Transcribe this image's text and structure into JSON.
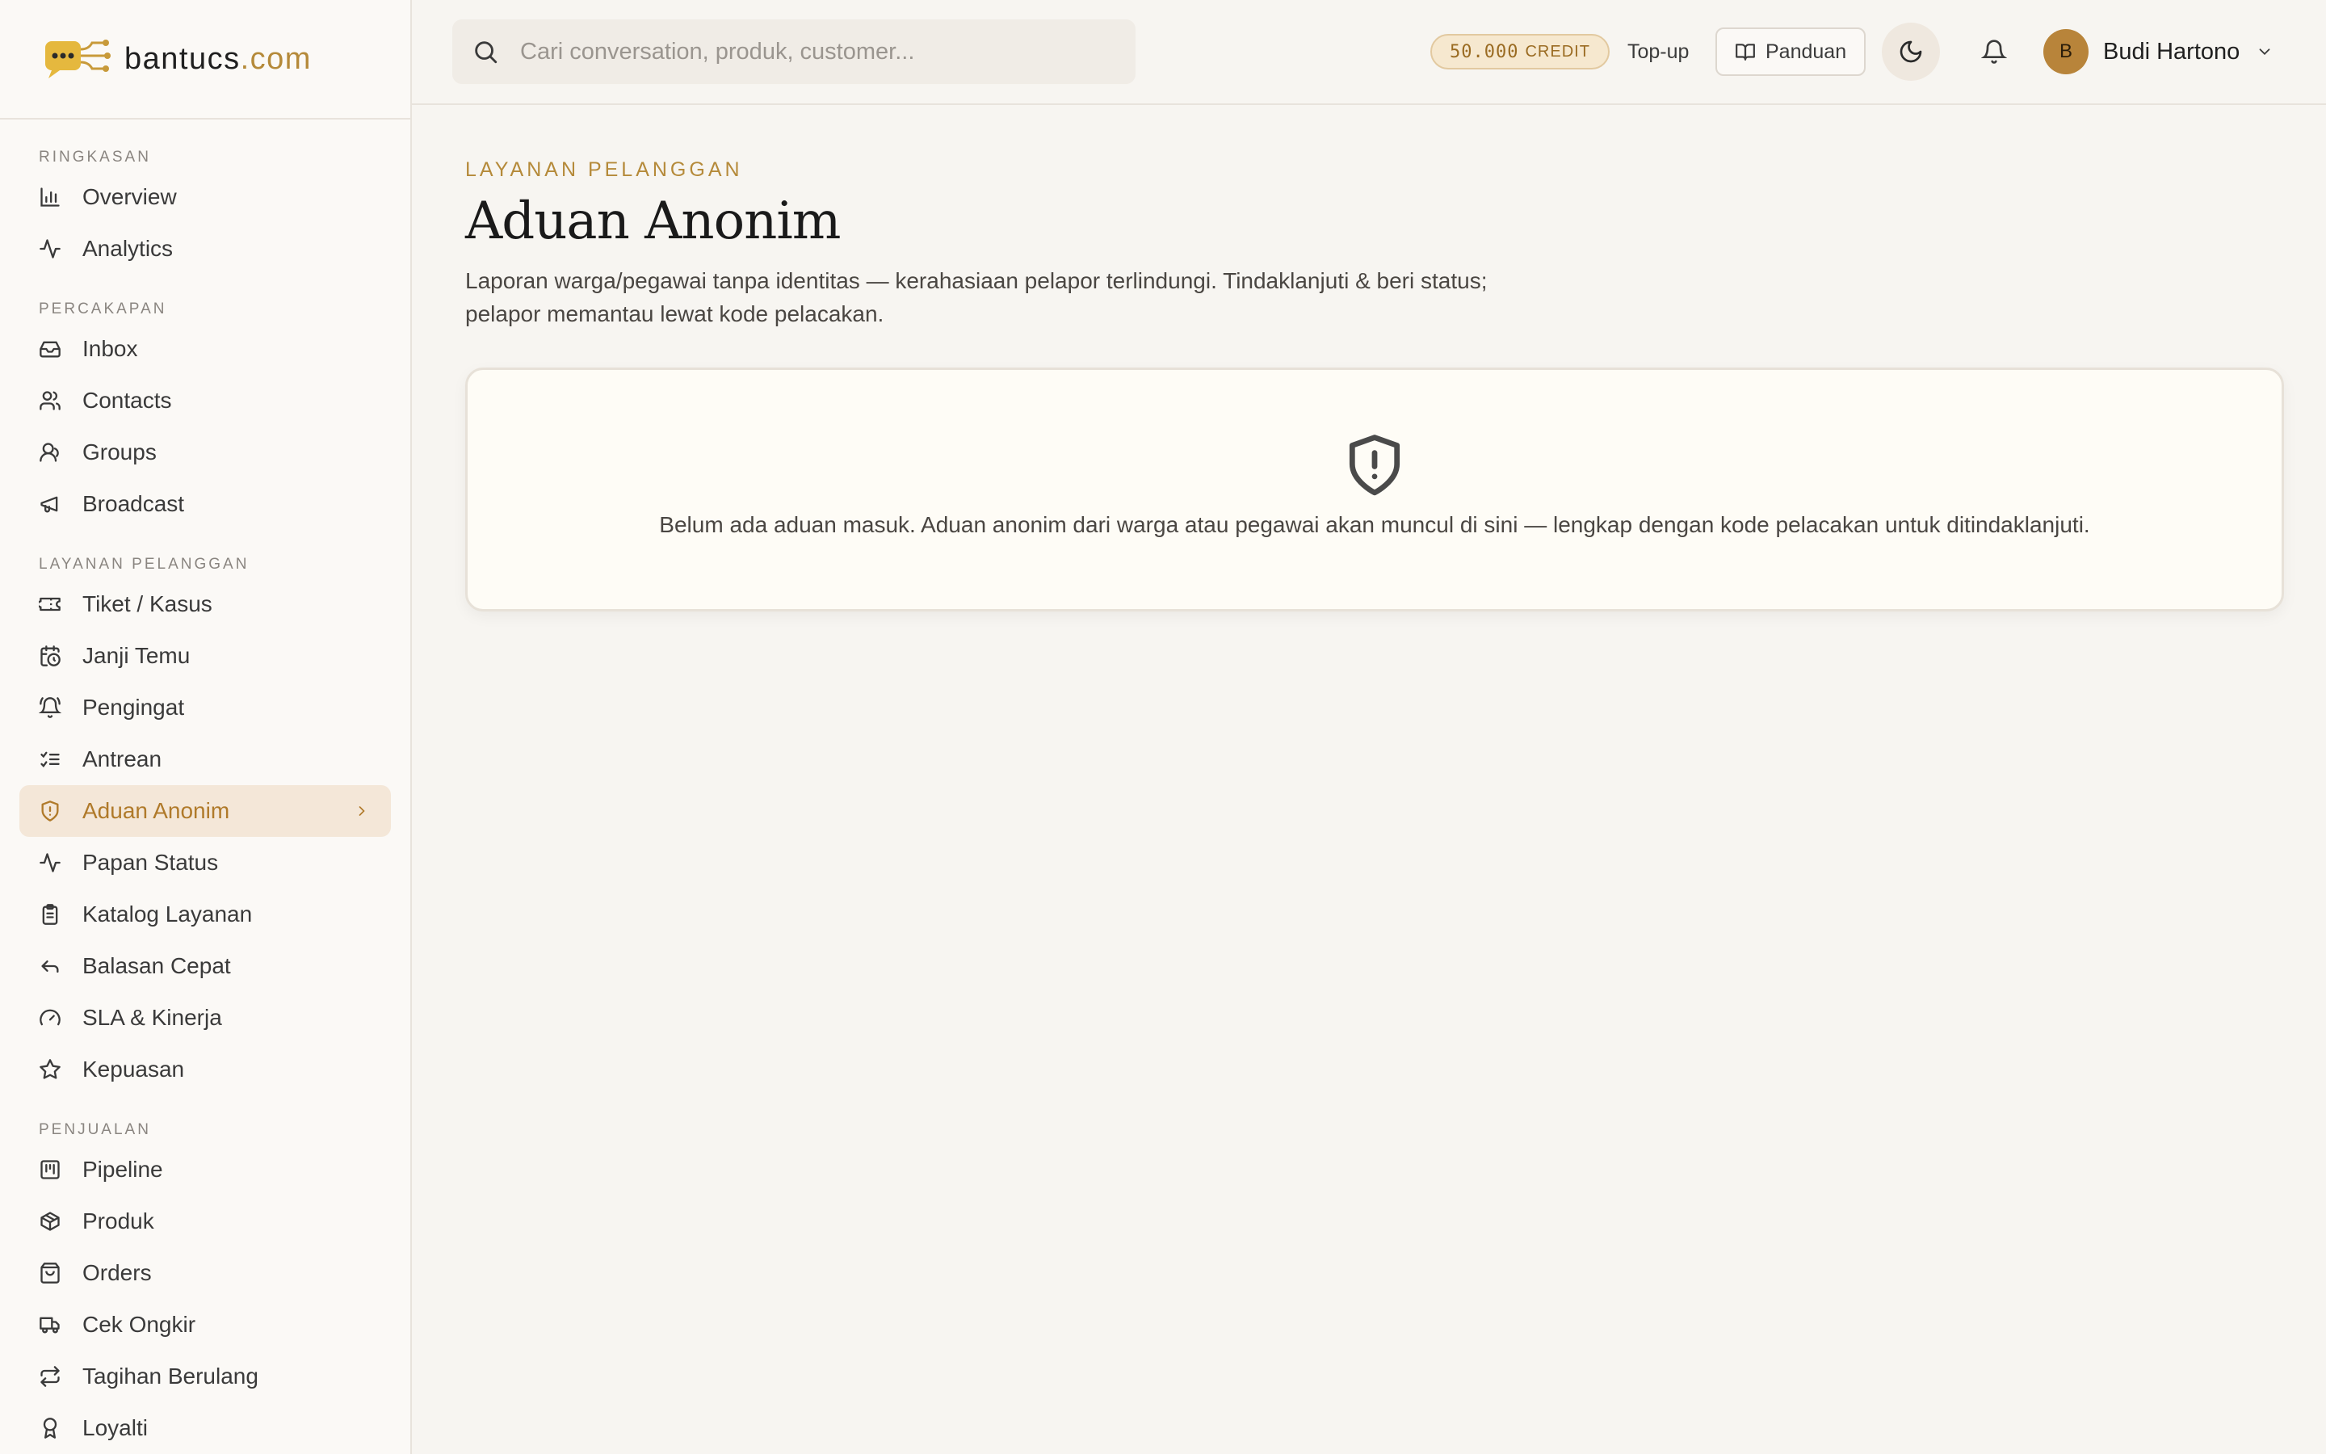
{
  "brand": {
    "name": "bantucs",
    "tld": ".com"
  },
  "sidebar": {
    "sections": [
      {
        "label": "RINGKASAN",
        "items": [
          {
            "label": "Overview",
            "icon": "bar-chart-icon"
          },
          {
            "label": "Analytics",
            "icon": "activity-icon"
          }
        ]
      },
      {
        "label": "PERCAKAPAN",
        "items": [
          {
            "label": "Inbox",
            "icon": "inbox-icon"
          },
          {
            "label": "Contacts",
            "icon": "users-icon"
          },
          {
            "label": "Groups",
            "icon": "user-group-icon"
          },
          {
            "label": "Broadcast",
            "icon": "megaphone-icon"
          }
        ]
      },
      {
        "label": "LAYANAN PELANGGAN",
        "items": [
          {
            "label": "Tiket / Kasus",
            "icon": "ticket-icon"
          },
          {
            "label": "Janji Temu",
            "icon": "calendar-clock-icon"
          },
          {
            "label": "Pengingat",
            "icon": "bell-ring-icon"
          },
          {
            "label": "Antrean",
            "icon": "list-checks-icon"
          },
          {
            "label": "Aduan Anonim",
            "icon": "shield-alert-icon",
            "active": true
          },
          {
            "label": "Papan Status",
            "icon": "activity-icon"
          },
          {
            "label": "Katalog Layanan",
            "icon": "clipboard-list-icon"
          },
          {
            "label": "Balasan Cepat",
            "icon": "reply-icon"
          },
          {
            "label": "SLA & Kinerja",
            "icon": "gauge-icon"
          },
          {
            "label": "Kepuasan",
            "icon": "star-icon"
          }
        ]
      },
      {
        "label": "PENJUALAN",
        "items": [
          {
            "label": "Pipeline",
            "icon": "kanban-icon"
          },
          {
            "label": "Produk",
            "icon": "package-icon"
          },
          {
            "label": "Orders",
            "icon": "shopping-bag-icon"
          },
          {
            "label": "Cek Ongkir",
            "icon": "truck-icon"
          },
          {
            "label": "Tagihan Berulang",
            "icon": "repeat-icon"
          },
          {
            "label": "Loyalti",
            "icon": "award-icon"
          }
        ]
      }
    ]
  },
  "topbar": {
    "search_placeholder": "Cari conversation, produk, customer...",
    "credit_amount": "50.000",
    "credit_label": "CREDIT",
    "topup_label": "Top-up",
    "panduan_label": "Panduan",
    "user_initial": "B",
    "user_name": "Budi Hartono"
  },
  "page": {
    "eyebrow": "LAYANAN PELANGGAN",
    "title": "Aduan Anonim",
    "description": "Laporan warga/pegawai tanpa identitas — kerahasiaan pelapor terlindungi. Tindaklanjuti & beri status; pelapor memantau lewat kode pelacakan.",
    "empty_state": "Belum ada aduan masuk. Aduan anonim dari warga atau pegawai akan muncul di sini — lengkap dengan kode pelacakan untuk ditindaklanjuti."
  },
  "colors": {
    "accent": "#b58a3a",
    "active_bg": "#f4e7d8",
    "background": "#f7f5f1"
  }
}
